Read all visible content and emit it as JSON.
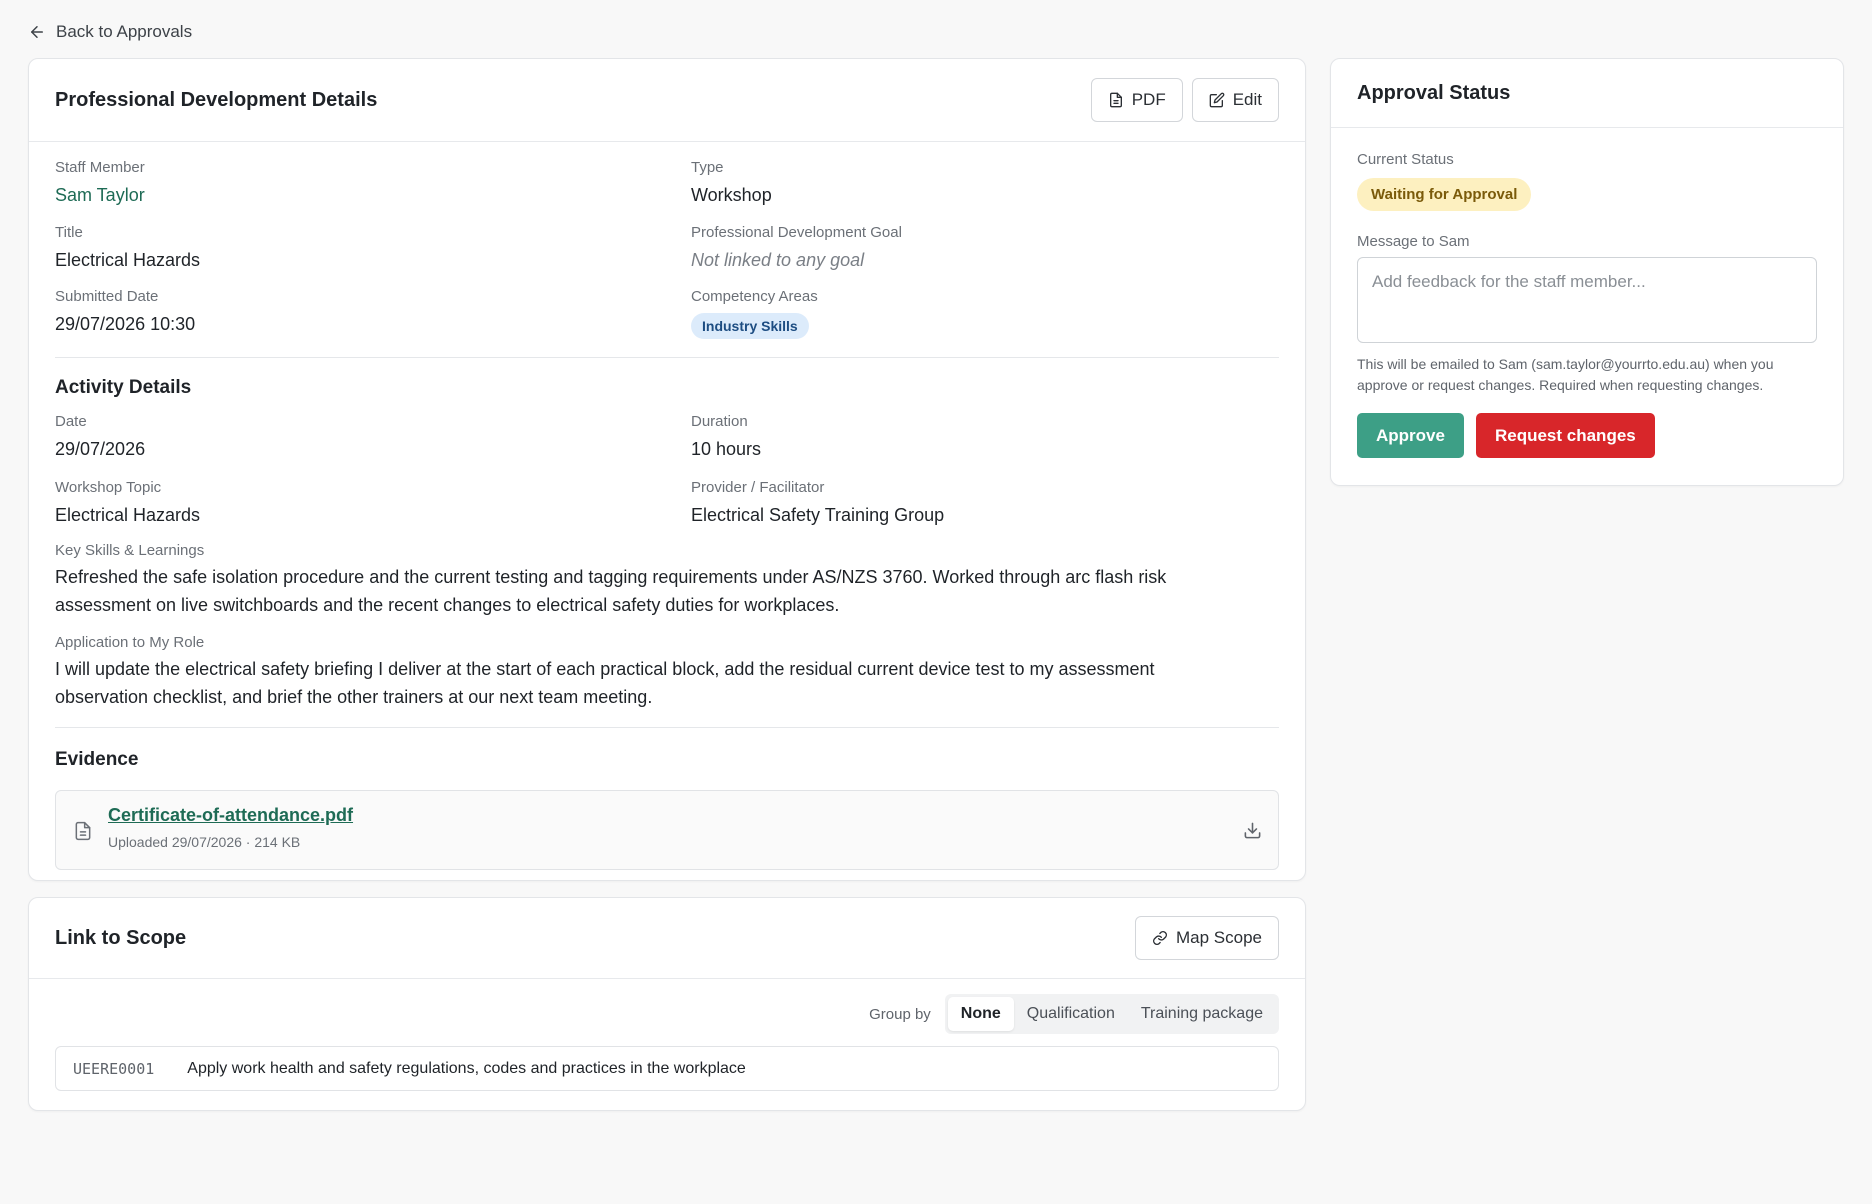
{
  "nav": {
    "back_label": "Back to Approvals"
  },
  "details": {
    "title": "Professional Development Details",
    "pdf_label": "PDF",
    "edit_label": "Edit",
    "staff_member_label": "Staff Member",
    "staff_member_value": "Sam Taylor",
    "type_label": "Type",
    "type_value": "Workshop",
    "title_label": "Title",
    "title_value": "Electrical Hazards",
    "goal_label": "Professional Development Goal",
    "goal_value": "Not linked to any goal",
    "submitted_label": "Submitted Date",
    "submitted_value": "29/07/2026 10:30",
    "competency_label": "Competency Areas",
    "competency_chip": "Industry Skills"
  },
  "activity": {
    "heading": "Activity Details",
    "date_label": "Date",
    "date_value": "29/07/2026",
    "duration_label": "Duration",
    "duration_value": "10 hours",
    "topic_label": "Workshop Topic",
    "topic_value": "Electrical Hazards",
    "provider_label": "Provider / Facilitator",
    "provider_value": "Electrical Safety Training Group",
    "skills_label": "Key Skills & Learnings",
    "skills_line1": "Refreshed the safe isolation procedure and the current testing and tagging requirements under AS/NZS 3760. Worked through arc flash risk",
    "skills_line2": "assessment on live switchboards and the recent changes to electrical safety duties for workplaces.",
    "application_label": "Application to My Role",
    "application_line1": "I will update the electrical safety briefing I deliver at the start of each practical block, add the residual current device test to my assessment",
    "application_line2": "observation checklist, and brief the other trainers at our next team meeting."
  },
  "evidence": {
    "heading": "Evidence",
    "file_name": "Certificate-of-attendance.pdf",
    "file_meta": "Uploaded 29/07/2026 · 214 KB"
  },
  "scope": {
    "title": "Link to Scope",
    "map_label": "Map Scope",
    "group_by_label": "Group by",
    "group_options": [
      "None",
      "Qualification",
      "Training package"
    ],
    "rows": [
      {
        "code": "UEERE0001",
        "text": "Apply work health and safety regulations, codes and practices in the workplace"
      }
    ]
  },
  "approval": {
    "title": "Approval Status",
    "current_status_label": "Current Status",
    "status_value": "Waiting for Approval",
    "message_label": "Message to Sam",
    "message_placeholder": "Add feedback for the staff member...",
    "help_line1": "This will be emailed to Sam (sam.taylor@yourrto.edu.au) when you",
    "help_line2": "approve or request changes. Required when requesting changes.",
    "approve_label": "Approve",
    "request_label": "Request changes"
  },
  "colors": {
    "accent_green": "#3d9f86",
    "link_green": "#1e6b55",
    "danger_red": "#d8262a",
    "badge_yellow": "#fdf0c0",
    "chip_blue": "#dcebfb"
  }
}
